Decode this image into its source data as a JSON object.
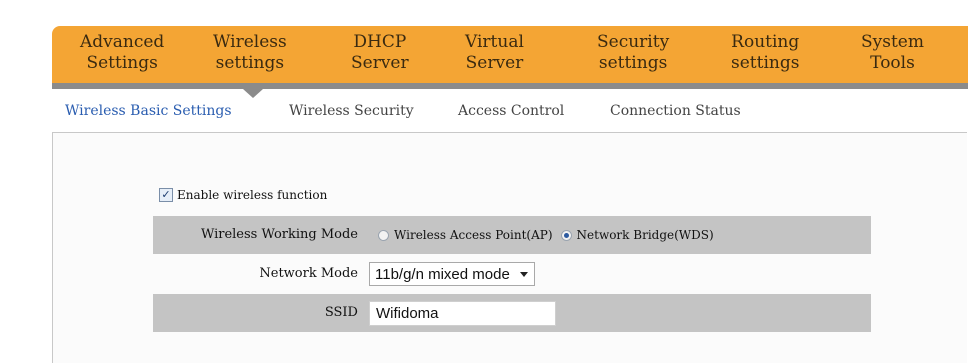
{
  "top_menu": [
    {
      "line1": "Advanced",
      "line2": "Settings"
    },
    {
      "line1": "Wireless",
      "line2": "settings"
    },
    {
      "line1": "DHCP",
      "line2": "Server"
    },
    {
      "line1": "Virtual",
      "line2": "Server"
    },
    {
      "line1": "Security",
      "line2": "settings"
    },
    {
      "line1": "Routing",
      "line2": "settings"
    },
    {
      "line1": "System",
      "line2": "Tools"
    }
  ],
  "active_menu": "Wireless settings",
  "sub_tabs": [
    {
      "label": "Wireless Basic Settings"
    },
    {
      "label": "Wireless Security"
    },
    {
      "label": "Access Control"
    },
    {
      "label": "Connection Status"
    }
  ],
  "form": {
    "enable_wireless": {
      "label": "Enable wireless function",
      "checked": true
    },
    "working_mode": {
      "label": "Wireless Working Mode",
      "options": [
        {
          "label": "Wireless Access Point(AP)",
          "checked": false
        },
        {
          "label": "Network Bridge(WDS)",
          "checked": true
        }
      ]
    },
    "network_mode": {
      "label": "Network Mode",
      "value": "11b/g/n mixed mode"
    },
    "ssid": {
      "label": "SSID",
      "value": "Wifidoma"
    }
  },
  "colors": {
    "menu_bg": "#f4a534",
    "active_tab": "#2a5db0",
    "shaded_row": "#c4c4c4"
  }
}
